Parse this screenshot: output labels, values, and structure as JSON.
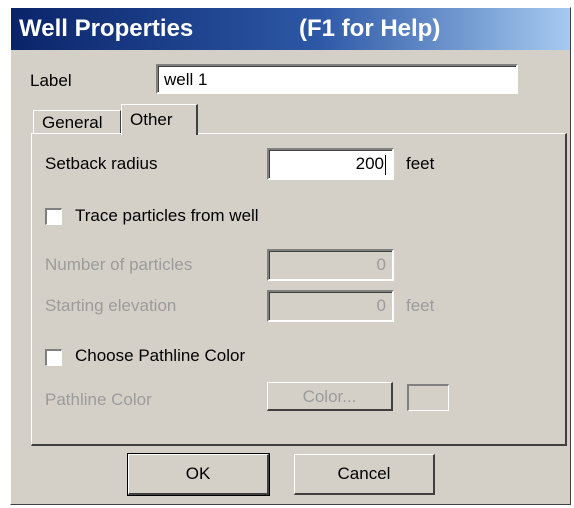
{
  "title": {
    "name": "Well Properties",
    "help": "(F1 for Help)"
  },
  "label_field": {
    "caption": "Label",
    "value": "well 1"
  },
  "tabs": [
    {
      "label": "General",
      "active": false
    },
    {
      "label": "Other",
      "active": true
    }
  ],
  "other_tab": {
    "setback": {
      "caption": "Setback radius",
      "value": "200",
      "unit": "feet"
    },
    "trace_particles": {
      "caption": "Trace particles from well",
      "checked": false
    },
    "number_of_particles": {
      "caption": "Number of particles",
      "value": "0",
      "enabled": false
    },
    "starting_elevation": {
      "caption": "Starting elevation",
      "value": "0",
      "unit": "feet",
      "enabled": false
    },
    "choose_pathline_color": {
      "caption": "Choose Pathline Color",
      "checked": false
    },
    "pathline_color": {
      "caption": "Pathline Color",
      "button_label": "Color...",
      "enabled": false
    }
  },
  "buttons": {
    "ok": "OK",
    "cancel": "Cancel"
  },
  "colors": {
    "titlebar_start": "#0a246a",
    "titlebar_end": "#a6caf0",
    "dialog_face": "#d4d0c8",
    "disabled_text": "#9c9c9c"
  }
}
